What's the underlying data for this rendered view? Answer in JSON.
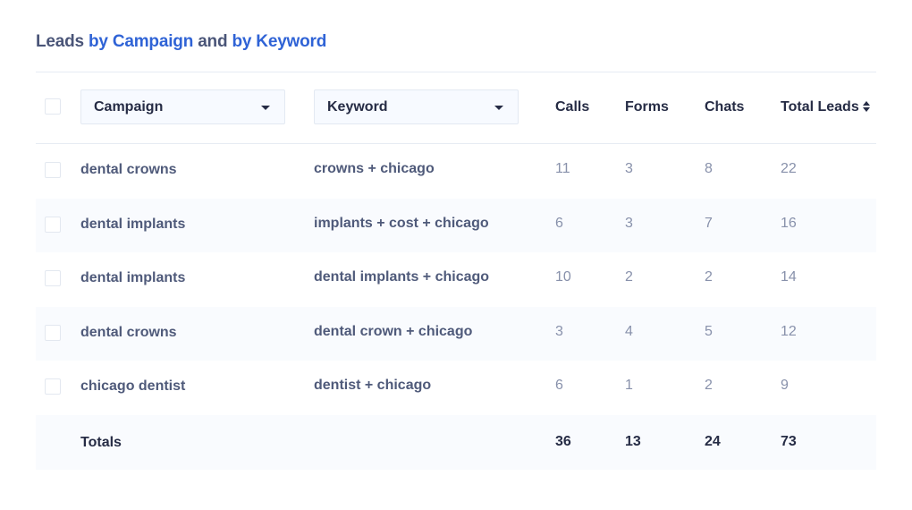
{
  "title": {
    "part1": "Leads ",
    "part2": "by Campaign",
    "part3": " and ",
    "part4": "by Keyword"
  },
  "colors": {
    "accent": "#2f63d6",
    "title_text": "#4a5578",
    "header_text": "#262c45",
    "cell_text": "#4f5a7a",
    "number_text": "#8891ab",
    "alt_row_bg": "#f9fbfe"
  },
  "header": {
    "campaign_select": "Campaign",
    "keyword_select": "Keyword",
    "calls": "Calls",
    "forms": "Forms",
    "chats": "Chats",
    "total_leads": "Total Leads",
    "sort_icon": "sort-up-down-icon",
    "dropdown_icon": "caret-down-icon"
  },
  "rows": [
    {
      "campaign": "dental crowns",
      "keyword": "crowns + chicago",
      "calls": "11",
      "forms": "3",
      "chats": "8",
      "total": "22"
    },
    {
      "campaign": "dental implants",
      "keyword": "implants + cost + chicago",
      "calls": "6",
      "forms": "3",
      "chats": "7",
      "total": "16"
    },
    {
      "campaign": "dental implants",
      "keyword": "dental implants + chicago",
      "calls": "10",
      "forms": "2",
      "chats": "2",
      "total": "14"
    },
    {
      "campaign": "dental crowns",
      "keyword": "dental crown + chicago",
      "calls": "3",
      "forms": "4",
      "chats": "5",
      "total": "12"
    },
    {
      "campaign": "chicago dentist",
      "keyword": "dentist + chicago",
      "calls": "6",
      "forms": "1",
      "chats": "2",
      "total": "9"
    }
  ],
  "totals": {
    "label": "Totals",
    "calls": "36",
    "forms": "13",
    "chats": "24",
    "total": "73"
  }
}
